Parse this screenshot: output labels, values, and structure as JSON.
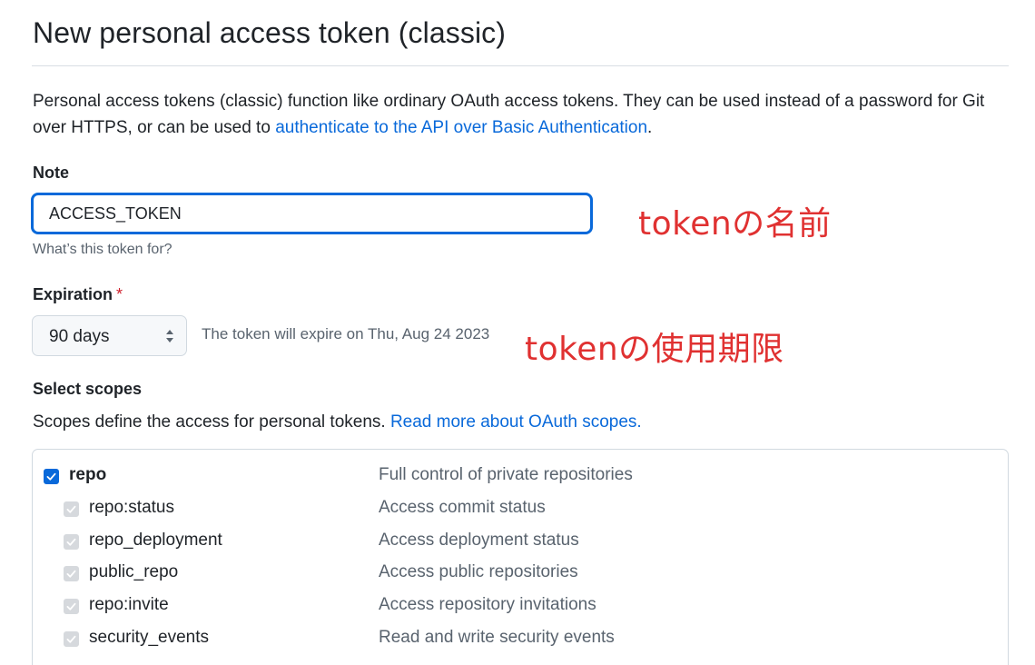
{
  "page": {
    "title": "New personal access token (classic)"
  },
  "intro": {
    "text": "Personal access tokens (classic) function like ordinary OAuth access tokens. They can be used instead of a password for Git over HTTPS, or can be used to ",
    "link": "authenticate to the API over Basic Authentication",
    "suffix": "."
  },
  "note": {
    "label": "Note",
    "value": "ACCESS_TOKEN",
    "hint": "What’s this token for?"
  },
  "expiration": {
    "label": "Expiration",
    "required_marker": "*",
    "selected": "90 days",
    "note": "The token will expire on Thu, Aug 24 2023"
  },
  "annotations": {
    "note_name": "tokenの名前",
    "expiry": "tokenの使用期限",
    "color": "#e03131"
  },
  "scopes": {
    "label": "Select scopes",
    "description": "Scopes define the access for personal tokens. ",
    "link": "Read more about OAuth scopes.",
    "items": [
      {
        "name": "repo",
        "description": "Full control of private repositories",
        "checked": true,
        "parent": true
      },
      {
        "name": "repo:status",
        "description": "Access commit status",
        "checked": true,
        "parent": false
      },
      {
        "name": "repo_deployment",
        "description": "Access deployment status",
        "checked": true,
        "parent": false
      },
      {
        "name": "public_repo",
        "description": "Access public repositories",
        "checked": true,
        "parent": false
      },
      {
        "name": "repo:invite",
        "description": "Access repository invitations",
        "checked": true,
        "parent": false
      },
      {
        "name": "security_events",
        "description": "Read and write security events",
        "checked": true,
        "parent": false
      }
    ]
  },
  "colors": {
    "accent": "#0969da",
    "danger": "#cf222e",
    "muted": "#59636e"
  }
}
